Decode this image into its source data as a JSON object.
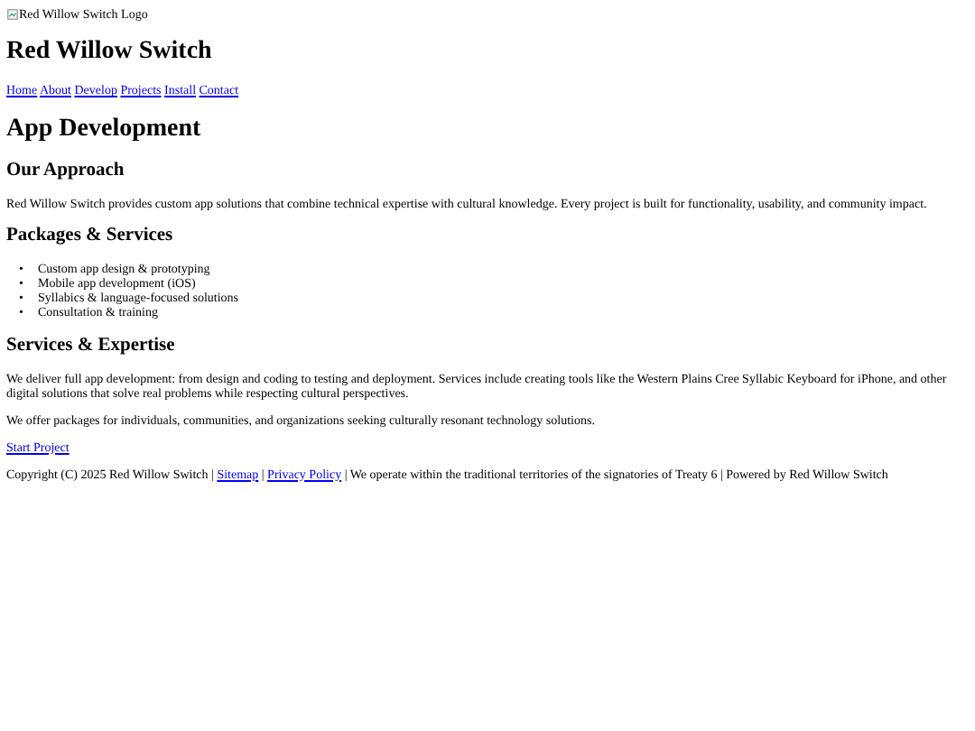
{
  "logo": {
    "alt": "Red Willow Switch Logo"
  },
  "site_title": "Red Willow Switch",
  "nav": [
    "Home",
    "About",
    "Develop",
    "Projects",
    "Install",
    "Contact"
  ],
  "page_title": "App Development",
  "sections": [
    {
      "heading": "Our Approach",
      "paragraphs": [
        "Red Willow Switch provides custom app solutions that combine technical expertise with cultural knowledge. Every project is built for functionality, usability, and community impact."
      ]
    },
    {
      "heading": "Packages & Services",
      "bullet": "•",
      "items": [
        "Custom app design & prototyping",
        "Mobile app development (iOS)",
        "Syllabics & language-focused solutions",
        "Consultation & training"
      ]
    },
    {
      "heading": "Services & Expertise",
      "paragraphs": [
        "We deliver full app development: from design and coding to testing and deployment. Services include creating tools like the Western Plains Cree Syllabic Keyboard for iPhone, and other digital solutions that solve real problems while respecting cultural perspectives.",
        "We offer packages for individuals, communities, and organizations seeking culturally resonant technology solutions."
      ]
    }
  ],
  "cta_link": "Start Project",
  "footer": [
    {
      "kind": "text",
      "text": "Copyright (C) 2025 Red Willow Switch |"
    },
    {
      "kind": "link",
      "text": "Sitemap"
    },
    {
      "kind": "text",
      "text": "|"
    },
    {
      "kind": "link",
      "text": "Privacy Policy"
    },
    {
      "kind": "text",
      "text": "| We operate within the traditional territories of the signatories of Treaty 6 | Powered by Red Willow Switch"
    }
  ]
}
